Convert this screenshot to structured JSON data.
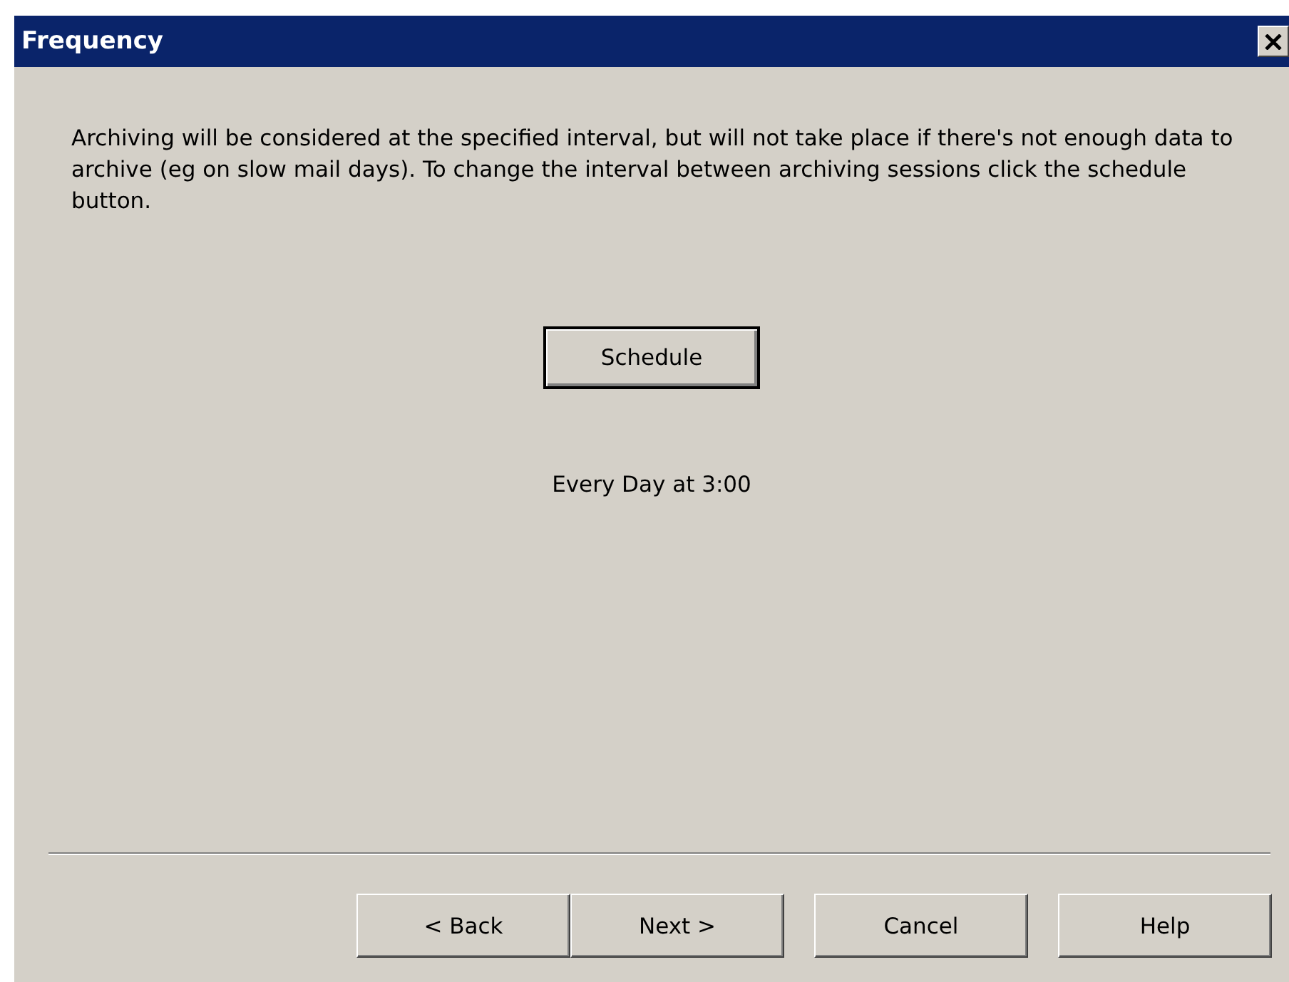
{
  "window": {
    "title": "Frequency"
  },
  "description": "Archiving will be considered at the specified interval, but will not take place if there's not enough data to archive (eg on slow mail days). To change the interval between archiving sessions click the schedule button.",
  "schedule_button": "Schedule",
  "schedule_summary": "Every Day at 3:00",
  "buttons": [
    {
      "label": "< Back"
    },
    {
      "label": "Next >"
    },
    {
      "label": "Cancel"
    },
    {
      "label": "Help"
    }
  ]
}
